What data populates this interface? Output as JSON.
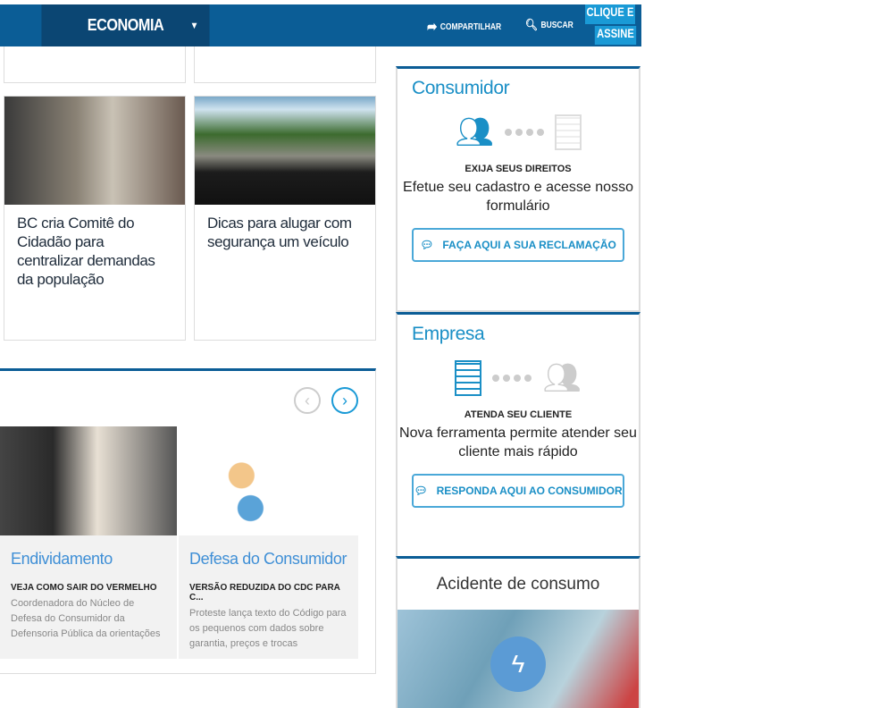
{
  "header": {
    "section": "ECONOMIA",
    "share": "COMPARTILHAR",
    "search": "BUSCAR",
    "cta_line1": "CLIQUE E",
    "cta_line2": "ASSINE"
  },
  "news": [
    {
      "title": "BC cria Comitê do Cidadão para centralizar demandas da população"
    },
    {
      "title": "Dicas para alugar com segurança um veículo"
    }
  ],
  "carousel": [
    {
      "title": "Endividamento",
      "kicker": "VEJA COMO SAIR DO VERMELHO",
      "desc": "Coordenadora do Núcleo de Defesa do Consumidor da Defensoria Pública da orientações"
    },
    {
      "title": "Defesa do Consumidor",
      "kicker": "VERSÃO REDUZIDA DO CDC PARA C...",
      "desc": "Proteste lança texto do Código para os pequenos com dados sobre garantia, preços e trocas"
    }
  ],
  "consumidor": {
    "title": "Consumidor",
    "kicker": "EXIJA SEUS DIREITOS",
    "desc": "Efetue seu cadastro e acesse nosso formulário",
    "button": "FAÇA AQUI A SUA RECLAMAÇÃO"
  },
  "empresa": {
    "title": "Empresa",
    "kicker": "ATENDA SEU CLIENTE",
    "desc": "Nova ferramenta permite atender seu cliente mais rápido",
    "button": "RESPONDA AQUI AO CONSUMIDOR"
  },
  "acidente": {
    "title": "Acidente de consumo"
  },
  "colors": {
    "header": "#0b5d96",
    "accent": "#1a9ad6"
  }
}
